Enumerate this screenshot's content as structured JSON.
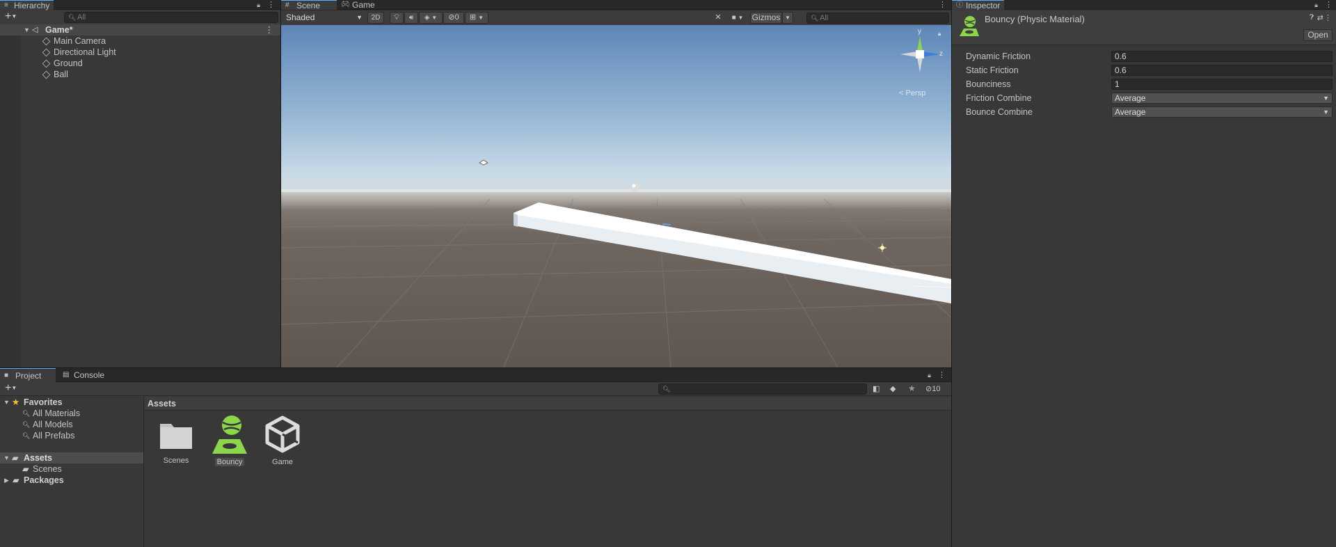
{
  "hierarchy": {
    "tab_label": "Hierarchy",
    "search_placeholder": "All",
    "scene_name": "Game*",
    "objects": [
      "Main Camera",
      "Directional Light",
      "Ground",
      "Ball"
    ]
  },
  "scene_view": {
    "tabs": [
      "Scene",
      "Game"
    ],
    "draw_mode": "Shaded",
    "mode_2d": "2D",
    "hidden_count": "0",
    "gizmos_label": "Gizmos",
    "search_placeholder": "All",
    "gizmo_axes": {
      "y": "y",
      "z": "z"
    },
    "projection_label": "< Persp"
  },
  "inspector": {
    "tab_label": "Inspector",
    "asset_title": "Bouncy (Physic Material)",
    "open_button": "Open",
    "properties": [
      {
        "label": "Dynamic Friction",
        "value": "0.6"
      },
      {
        "label": "Static Friction",
        "value": "0.6"
      },
      {
        "label": "Bounciness",
        "value": "1"
      }
    ],
    "dropdowns": [
      {
        "label": "Friction Combine",
        "value": "Average"
      },
      {
        "label": "Bounce Combine",
        "value": "Average"
      }
    ]
  },
  "project": {
    "tabs": [
      "Project",
      "Console"
    ],
    "favorites_label": "Favorites",
    "favorites": [
      "All Materials",
      "All Models",
      "All Prefabs"
    ],
    "assets_label": "Assets",
    "asset_folders": [
      "Scenes"
    ],
    "packages_label": "Packages",
    "breadcrumb": "Assets",
    "hidden_packages_count": "10",
    "assets": [
      {
        "name": "Scenes",
        "icon": "folder-icon"
      },
      {
        "name": "Bouncy",
        "icon": "physic-material-icon"
      },
      {
        "name": "Game",
        "icon": "unity-scene-icon"
      }
    ]
  },
  "colors": {
    "accent": "#58b4ff",
    "selection": "#4d4d4d",
    "physic_material_green": "#8bd64a",
    "gizmo_y": "#8bd64a",
    "gizmo_z": "#3b7ee0"
  }
}
